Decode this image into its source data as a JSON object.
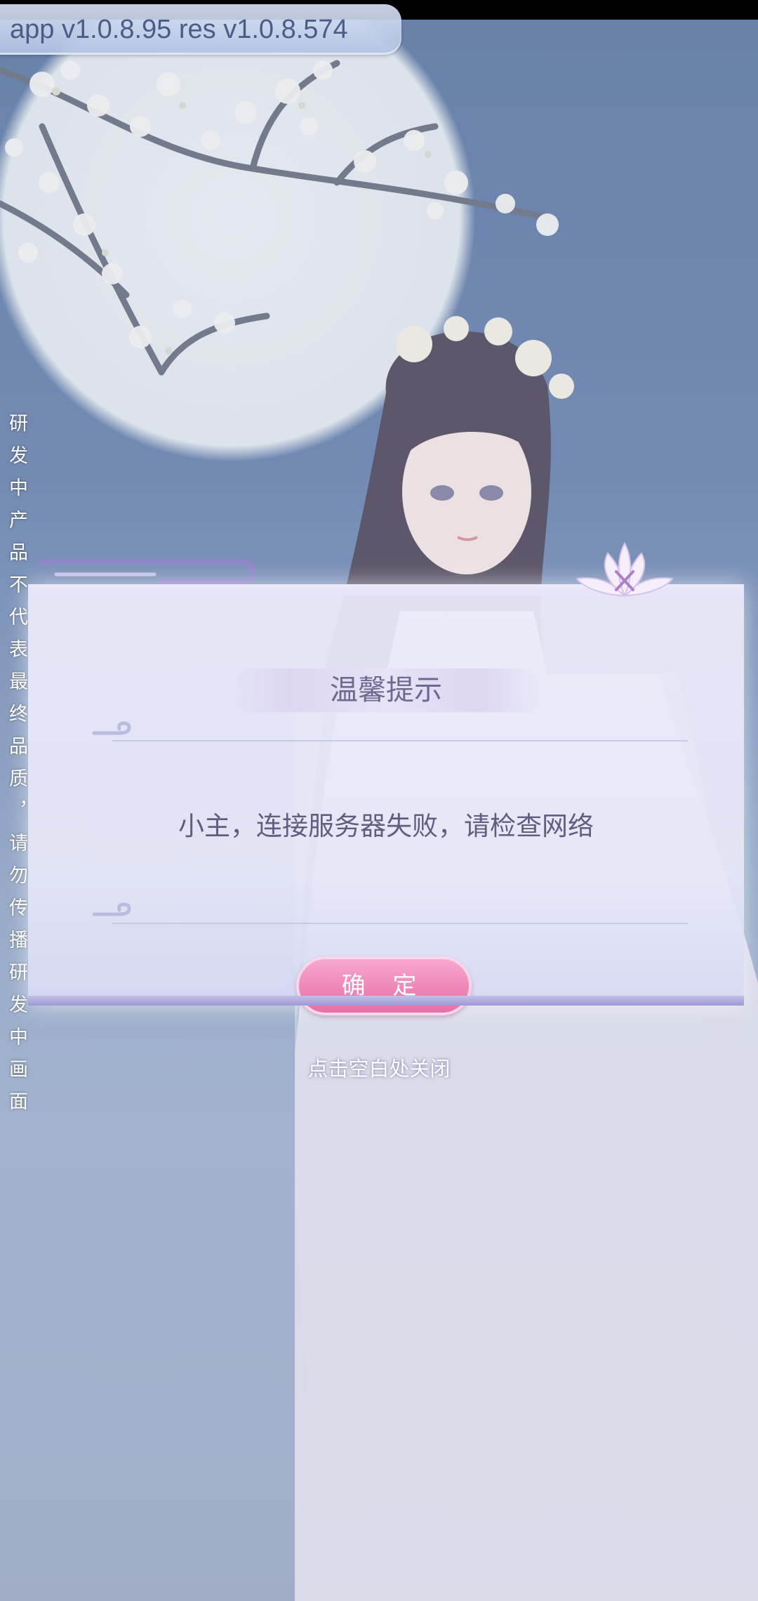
{
  "top_bar": {
    "version_label": "app v1.0.8.95 res v1.0.8.574"
  },
  "side_notice": {
    "text": "研发中产品不代表最终品质，请勿传播研发中画面"
  },
  "dialog": {
    "title": "温馨提示",
    "message": "小主，连接服务器失败，请检查网络",
    "confirm_label": "确 定",
    "close_icon": "lotus-close-icon"
  },
  "close_hint": "点击空白处关闭",
  "colors": {
    "confirm_button": "#ef86b8",
    "dialog_text": "#5f5e80",
    "title_text": "#6c6a8e"
  }
}
